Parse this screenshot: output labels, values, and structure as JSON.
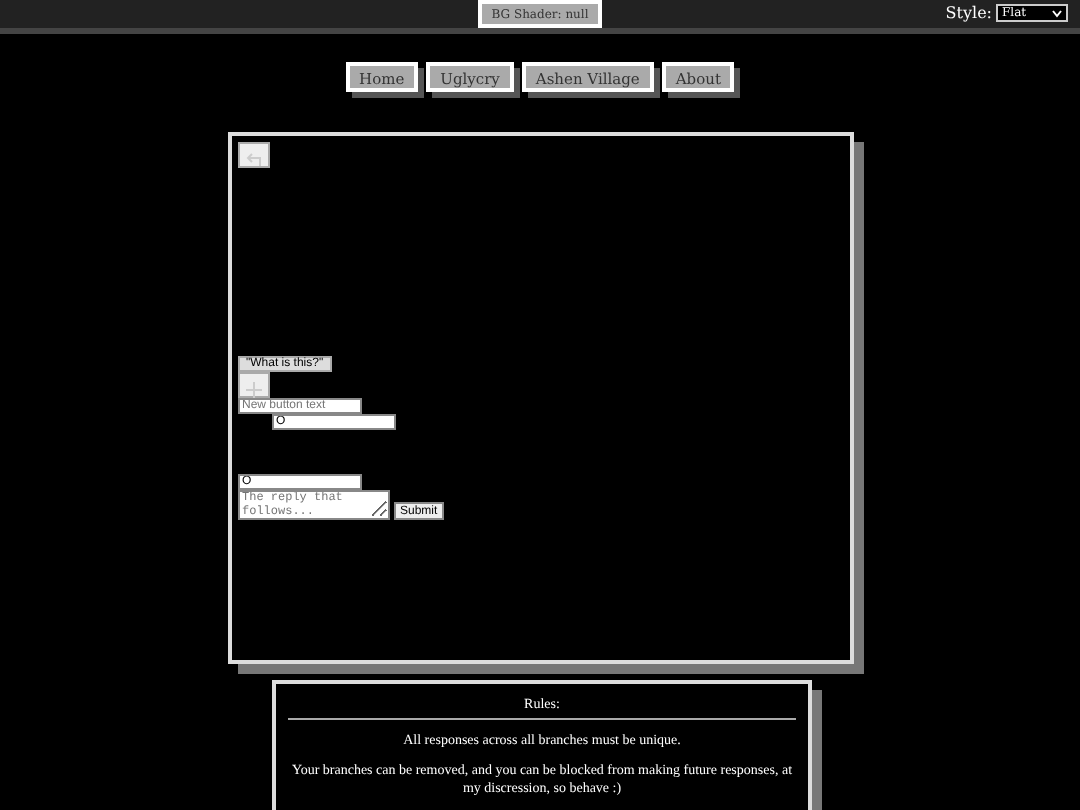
{
  "top_bar": {
    "shader_button": "BG Shader: null",
    "style_label": "Style:",
    "style_select": "Flat"
  },
  "nav": [
    {
      "label": "Home"
    },
    {
      "label": "Uglycry"
    },
    {
      "label": "Ashen Village"
    },
    {
      "label": "About"
    }
  ],
  "editor": {
    "prompt_button": "\"What is this?\"",
    "new_button_placeholder": "New button text",
    "new_button_value": "O",
    "reply_value": "O",
    "reply_placeholder": "The reply that follows...",
    "submit": "Submit"
  },
  "rules": {
    "title": "Rules:",
    "paragraphs": [
      "All responses across all branches must be unique.",
      "Your branches can be removed, and you can be blocked from making future responses, at my discression, so behave :)"
    ]
  }
}
